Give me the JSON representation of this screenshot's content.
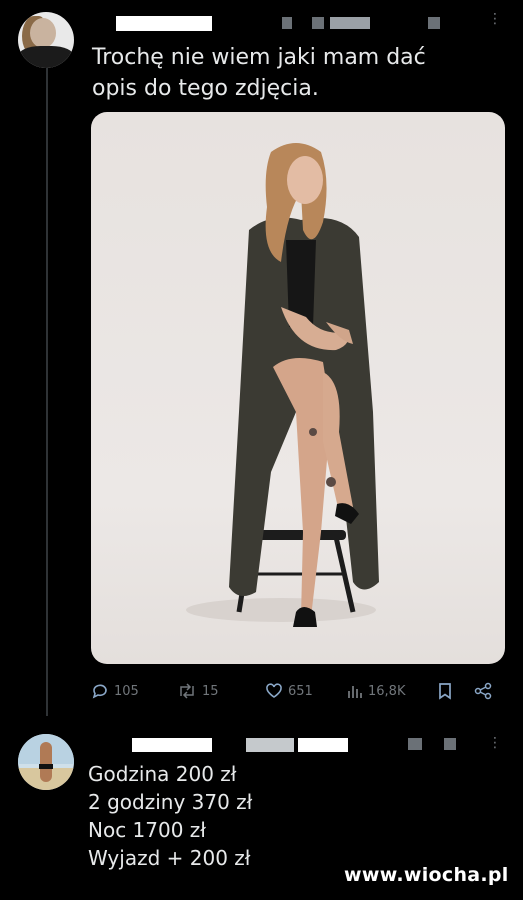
{
  "tweet": {
    "text_line1": "Trochę nie wiem jaki mam dać",
    "text_line2": "opis do tego zdjęcia.",
    "stats": {
      "replies": "105",
      "retweets": "15",
      "likes": "651",
      "views": "16,8K"
    }
  },
  "reply": {
    "lines": [
      "Godzina 200 zł",
      "2 godziny 370 zł",
      "Noc 1700 zł",
      "Wyjazd + 200 zł"
    ]
  },
  "watermark": "www.wiocha.pl",
  "colors": {
    "background": "#000000",
    "text": "#e7e9ea",
    "muted": "#71767b",
    "thread_line": "#2f3336"
  },
  "icons": [
    "reply-icon",
    "retweet-icon",
    "like-icon",
    "views-icon",
    "bookmark-icon",
    "share-icon",
    "more-icon"
  ]
}
